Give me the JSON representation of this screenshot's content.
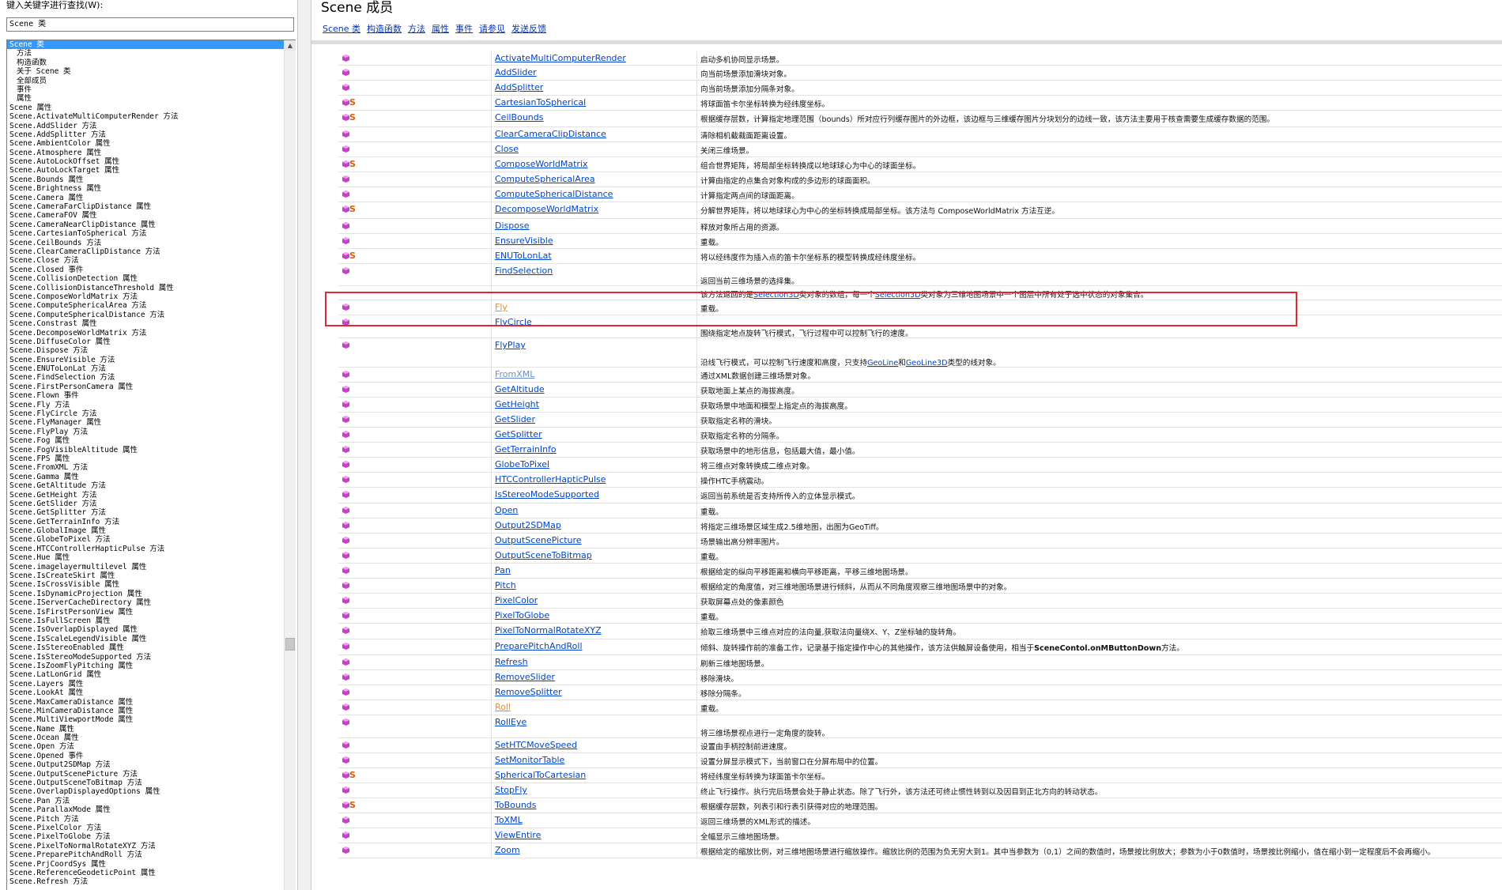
{
  "left_pane": {
    "search_label": "键入关键字进行查找(W):",
    "search_value": "Scene 类",
    "index_items": [
      {
        "text": "Scene 类",
        "selected": true,
        "sub": false
      },
      {
        "text": "方法",
        "selected": false,
        "sub": true
      },
      {
        "text": "构造函数",
        "selected": false,
        "sub": true
      },
      {
        "text": "关于 Scene 类",
        "selected": false,
        "sub": true
      },
      {
        "text": "全部成员",
        "selected": false,
        "sub": true
      },
      {
        "text": "事件",
        "selected": false,
        "sub": true
      },
      {
        "text": "属性",
        "selected": false,
        "sub": true
      },
      {
        "text": "Scene 属性",
        "selected": false,
        "sub": false
      },
      {
        "text": "Scene.ActivateMultiComputerRender 方法",
        "selected": false,
        "sub": false
      },
      {
        "text": "Scene.AddSlider 方法",
        "selected": false,
        "sub": false
      },
      {
        "text": "Scene.AddSplitter 方法",
        "selected": false,
        "sub": false
      },
      {
        "text": "Scene.AmbientColor 属性",
        "selected": false,
        "sub": false
      },
      {
        "text": "Scene.Atmosphere 属性",
        "selected": false,
        "sub": false
      },
      {
        "text": "Scene.AutoLockOffset 属性",
        "selected": false,
        "sub": false
      },
      {
        "text": "Scene.AutoLockTarget 属性",
        "selected": false,
        "sub": false
      },
      {
        "text": "Scene.Bounds 属性",
        "selected": false,
        "sub": false
      },
      {
        "text": "Scene.Brightness 属性",
        "selected": false,
        "sub": false
      },
      {
        "text": "Scene.Camera 属性",
        "selected": false,
        "sub": false
      },
      {
        "text": "Scene.CameraFarClipDistance 属性",
        "selected": false,
        "sub": false
      },
      {
        "text": "Scene.CameraFOV 属性",
        "selected": false,
        "sub": false
      },
      {
        "text": "Scene.CameraNearClipDistance 属性",
        "selected": false,
        "sub": false
      },
      {
        "text": "Scene.CartesianToSpherical 方法",
        "selected": false,
        "sub": false
      },
      {
        "text": "Scene.CeilBounds 方法",
        "selected": false,
        "sub": false
      },
      {
        "text": "Scene.ClearCameraClipDistance 方法",
        "selected": false,
        "sub": false
      },
      {
        "text": "Scene.Close 方法",
        "selected": false,
        "sub": false
      },
      {
        "text": "Scene.Closed 事件",
        "selected": false,
        "sub": false
      },
      {
        "text": "Scene.CollisionDetection 属性",
        "selected": false,
        "sub": false
      },
      {
        "text": "Scene.CollisionDistanceThreshold 属性",
        "selected": false,
        "sub": false
      },
      {
        "text": "Scene.ComposeWorldMatrix 方法",
        "selected": false,
        "sub": false
      },
      {
        "text": "Scene.ComputeSphericalArea 方法",
        "selected": false,
        "sub": false
      },
      {
        "text": "Scene.ComputeSphericalDistance 方法",
        "selected": false,
        "sub": false
      },
      {
        "text": "Scene.Constrast 属性",
        "selected": false,
        "sub": false
      },
      {
        "text": "Scene.DecomposeWorldMatrix 方法",
        "selected": false,
        "sub": false
      },
      {
        "text": "Scene.DiffuseColor 属性",
        "selected": false,
        "sub": false
      },
      {
        "text": "Scene.Dispose 方法",
        "selected": false,
        "sub": false
      },
      {
        "text": "Scene.EnsureVisible 方法",
        "selected": false,
        "sub": false
      },
      {
        "text": "Scene.ENUToLonLat 方法",
        "selected": false,
        "sub": false
      },
      {
        "text": "Scene.FindSelection 方法",
        "selected": false,
        "sub": false
      },
      {
        "text": "Scene.FirstPersonCamera 属性",
        "selected": false,
        "sub": false
      },
      {
        "text": "Scene.Flown 事件",
        "selected": false,
        "sub": false
      },
      {
        "text": "Scene.Fly 方法",
        "selected": false,
        "sub": false
      },
      {
        "text": "Scene.FlyCircle 方法",
        "selected": false,
        "sub": false
      },
      {
        "text": "Scene.FlyManager 属性",
        "selected": false,
        "sub": false
      },
      {
        "text": "Scene.FlyPlay 方法",
        "selected": false,
        "sub": false
      },
      {
        "text": "Scene.Fog 属性",
        "selected": false,
        "sub": false
      },
      {
        "text": "Scene.FogVisibleAltitude 属性",
        "selected": false,
        "sub": false
      },
      {
        "text": "Scene.FPS 属性",
        "selected": false,
        "sub": false
      },
      {
        "text": "Scene.FromXML 方法",
        "selected": false,
        "sub": false
      },
      {
        "text": "Scene.Gamma 属性",
        "selected": false,
        "sub": false
      },
      {
        "text": "Scene.GetAltitude 方法",
        "selected": false,
        "sub": false
      },
      {
        "text": "Scene.GetHeight 方法",
        "selected": false,
        "sub": false
      },
      {
        "text": "Scene.GetSlider 方法",
        "selected": false,
        "sub": false
      },
      {
        "text": "Scene.GetSplitter 方法",
        "selected": false,
        "sub": false
      },
      {
        "text": "Scene.GetTerrainInfo 方法",
        "selected": false,
        "sub": false
      },
      {
        "text": "Scene.GlobalImage 属性",
        "selected": false,
        "sub": false
      },
      {
        "text": "Scene.GlobeToPixel 方法",
        "selected": false,
        "sub": false
      },
      {
        "text": "Scene.HTCControllerHapticPulse 方法",
        "selected": false,
        "sub": false
      },
      {
        "text": "Scene.Hue 属性",
        "selected": false,
        "sub": false
      },
      {
        "text": "Scene.imagelayermultilevel 属性",
        "selected": false,
        "sub": false
      },
      {
        "text": "Scene.IsCreateSkirt 属性",
        "selected": false,
        "sub": false
      },
      {
        "text": "Scene.IsCrossVisible 属性",
        "selected": false,
        "sub": false
      },
      {
        "text": "Scene.IsDynamicProjection 属性",
        "selected": false,
        "sub": false
      },
      {
        "text": "Scene.IServerCacheDirectory 属性",
        "selected": false,
        "sub": false
      },
      {
        "text": "Scene.IsFirstPersonView 属性",
        "selected": false,
        "sub": false
      },
      {
        "text": "Scene.IsFullScreen 属性",
        "selected": false,
        "sub": false
      },
      {
        "text": "Scene.IsOverlapDisplayed 属性",
        "selected": false,
        "sub": false
      },
      {
        "text": "Scene.IsScaleLegendVisible 属性",
        "selected": false,
        "sub": false
      },
      {
        "text": "Scene.IsStereoEnabled 属性",
        "selected": false,
        "sub": false
      },
      {
        "text": "Scene.IsStereoModeSupported 方法",
        "selected": false,
        "sub": false
      },
      {
        "text": "Scene.IsZoomFlyPitching 属性",
        "selected": false,
        "sub": false
      },
      {
        "text": "Scene.LatLonGrid 属性",
        "selected": false,
        "sub": false
      },
      {
        "text": "Scene.Layers 属性",
        "selected": false,
        "sub": false
      },
      {
        "text": "Scene.LookAt 属性",
        "selected": false,
        "sub": false
      },
      {
        "text": "Scene.MaxCameraDistance 属性",
        "selected": false,
        "sub": false
      },
      {
        "text": "Scene.MinCameraDistance 属性",
        "selected": false,
        "sub": false
      },
      {
        "text": "Scene.MultiViewportMode 属性",
        "selected": false,
        "sub": false
      },
      {
        "text": "Scene.Name 属性",
        "selected": false,
        "sub": false
      },
      {
        "text": "Scene.Ocean 属性",
        "selected": false,
        "sub": false
      },
      {
        "text": "Scene.Open 方法",
        "selected": false,
        "sub": false
      },
      {
        "text": "Scene.Opened 事件",
        "selected": false,
        "sub": false
      },
      {
        "text": "Scene.Output2SDMap 方法",
        "selected": false,
        "sub": false
      },
      {
        "text": "Scene.OutputScenePicture 方法",
        "selected": false,
        "sub": false
      },
      {
        "text": "Scene.OutputSceneToBitmap 方法",
        "selected": false,
        "sub": false
      },
      {
        "text": "Scene.OverlapDisplayedOptions 属性",
        "selected": false,
        "sub": false
      },
      {
        "text": "Scene.Pan 方法",
        "selected": false,
        "sub": false
      },
      {
        "text": "Scene.ParallaxMode 属性",
        "selected": false,
        "sub": false
      },
      {
        "text": "Scene.Pitch 方法",
        "selected": false,
        "sub": false
      },
      {
        "text": "Scene.PixelColor 方法",
        "selected": false,
        "sub": false
      },
      {
        "text": "Scene.PixelToGlobe 方法",
        "selected": false,
        "sub": false
      },
      {
        "text": "Scene.PixelToNormalRotateXYZ 方法",
        "selected": false,
        "sub": false
      },
      {
        "text": "Scene.PreparePitchAndRoll 方法",
        "selected": false,
        "sub": false
      },
      {
        "text": "Scene.PrjCoordSys 属性",
        "selected": false,
        "sub": false
      },
      {
        "text": "Scene.ReferenceGeodeticPoint 属性",
        "selected": false,
        "sub": false
      },
      {
        "text": "Scene.Refresh 方法",
        "selected": false,
        "sub": false
      }
    ],
    "scroll_up_glyph": "▲",
    "scroll_position": 0.72
  },
  "right_pane": {
    "title": "Scene 成员",
    "nav_links": [
      "Scene 类",
      "构造函数",
      "方法",
      "属性",
      "事件",
      "请参见",
      "发送反馈"
    ],
    "members": [
      {
        "name": "ActivateMultiComputerRender",
        "static": false,
        "desc": "启动多机协同显示场景。"
      },
      {
        "name": "AddSlider",
        "static": false,
        "desc": "向当前场景添加滑块对象。"
      },
      {
        "name": "AddSplitter",
        "static": false,
        "desc": "向当前场景添加分隔条对象。"
      },
      {
        "name": "CartesianToSpherical",
        "static": true,
        "desc": "将球面笛卡尔坐标转换为经纬度坐标。"
      },
      {
        "name": "CeilBounds",
        "static": true,
        "desc": "根据缓存层数，计算指定地理范围（bounds）所对应行列缓存图片的外边框，该边框与三维缓存图片分块划分的边线一致，该方法主要用于核查需要生成缓存数据的范围。"
      },
      {
        "name": "ClearCameraClipDistance",
        "static": false,
        "desc": "清除相机截裁面距离设置。"
      },
      {
        "name": "Close",
        "static": false,
        "desc": "关闭三维场景。"
      },
      {
        "name": "ComposeWorldMatrix",
        "static": true,
        "desc": "组合世界矩阵，将局部坐标转换成以地球球心为中心的球面坐标。"
      },
      {
        "name": "ComputeSphericalArea",
        "static": false,
        "desc": "计算由指定的点集合对象构成的多边形的球面面积。"
      },
      {
        "name": "ComputeSphericalDistance",
        "static": false,
        "desc": "计算指定两点间的球面距离。"
      },
      {
        "name": "DecomposeWorldMatrix",
        "static": true,
        "desc": "分解世界矩阵，将以地球球心为中心的坐标转换成局部坐标。该方法与 ComposeWorldMatrix 方法互逆。"
      },
      {
        "name": "Dispose",
        "static": false,
        "desc": "释放对象所占用的资源。"
      },
      {
        "name": "EnsureVisible",
        "static": false,
        "desc": "重载。"
      },
      {
        "name": "ENUToLonLat",
        "static": true,
        "desc": "将以经纬度作为插入点的笛卡尔坐标系的模型转换成经纬度坐标。"
      },
      {
        "name": "FindSelection",
        "static": false,
        "desc": "返回当前三维场景的选择集。"
      },
      {
        "name": "",
        "static": false,
        "desc_parts": [
          "该方法返回的是",
          "Selection3D",
          "类对象的数组，每一个",
          "Selection3D",
          "类对象为三维地图场景中一个图层中所有处于选中状态的对象集合。"
        ]
      },
      {
        "name": "Fly",
        "static": false,
        "desc": "重载。"
      },
      {
        "name": "FlyCircle",
        "static": false,
        "desc": "围绕指定地点旋转飞行模式，飞行过程中可以控制飞行的速度。"
      },
      {
        "name": "FlyPlay",
        "static": false,
        "desc_parts": [
          "沿线飞行模式，可以控制飞行速度和高度，只支持",
          "GeoLine",
          "和",
          "GeoLine3D",
          "类型的线对象。"
        ]
      },
      {
        "name": "FromXML",
        "static": false,
        "desc": "通过XML数据创建三维场景对象。"
      },
      {
        "name": "GetAltitude",
        "static": false,
        "desc": "获取地面上某点的海拔高度。"
      },
      {
        "name": "GetHeight",
        "static": false,
        "desc": "获取场景中地面和模型上指定点的海拔高度。"
      },
      {
        "name": "GetSlider",
        "static": false,
        "desc": "获取指定名称的滑块。"
      },
      {
        "name": "GetSplitter",
        "static": false,
        "desc": "获取指定名称的分隔条。"
      },
      {
        "name": "GetTerrainInfo",
        "static": false,
        "desc": "获取场景中的地形信息，包括最大值，最小值。"
      },
      {
        "name": "GlobeToPixel",
        "static": false,
        "desc": "将三维点对象转换成二维点对象。"
      },
      {
        "name": "HTCControllerHapticPulse",
        "static": false,
        "desc": "操作HTC手柄震动。"
      },
      {
        "name": "IsStereoModeSupported",
        "static": false,
        "desc": "返回当前系统是否支持所传入的立体显示模式。"
      },
      {
        "name": "Open",
        "static": false,
        "desc": "重载。"
      },
      {
        "name": "Output2SDMap",
        "static": false,
        "desc": "将指定三维场景区域生成2.5维地图，出图为GeoTiff。"
      },
      {
        "name": "OutputScenePicture",
        "static": false,
        "desc": "场景输出高分辨率图片。"
      },
      {
        "name": "OutputSceneToBitmap",
        "static": false,
        "desc": "重载。"
      },
      {
        "name": "Pan",
        "static": false,
        "desc": "根据给定的纵向平移距离和横向平移距离，平移三维地图场景。"
      },
      {
        "name": "Pitch",
        "static": false,
        "desc": "根据给定的角度值，对三维地图场景进行倾斜，从而从不同角度观察三维地图场景中的对象。"
      },
      {
        "name": "PixelColor",
        "static": false,
        "desc": "获取屏幕点处的像素颜色"
      },
      {
        "name": "PixelToGlobe",
        "static": false,
        "desc": "重载。"
      },
      {
        "name": "PixelToNormalRotateXYZ",
        "static": false,
        "desc": "拾取三维场景中三维点对应的法向量,获取法向量绕X、Y、Z坐标轴的旋转角。"
      },
      {
        "name": "PreparePitchAndRoll",
        "static": false,
        "desc_parts": [
          "倾斜、旋转操作前的准备工作，记录基于指定操作中心的其他操作，该方法供触屏设备使用，相当于",
          "SceneContol.onMButtonDown",
          "方法。"
        ]
      },
      {
        "name": "Refresh",
        "static": false,
        "desc": "刷新三维地图场景。"
      },
      {
        "name": "RemoveSlider",
        "static": false,
        "desc": "移除滑块。"
      },
      {
        "name": "RemoveSplitter",
        "static": false,
        "desc": "移除分隔条。"
      },
      {
        "name": "Roll",
        "static": false,
        "desc": "重载。"
      },
      {
        "name": "RollEye",
        "static": false,
        "desc": "将三维场景视点进行一定角度的旋转。"
      },
      {
        "name": "SetHTCMoveSpeed",
        "static": false,
        "desc": "设置由手柄控制前进速度。"
      },
      {
        "name": "SetMonitorTable",
        "static": false,
        "desc": "设置分屏显示模式下，当前窗口在分屏布局中的位置。"
      },
      {
        "name": "SphericalToCartesian",
        "static": true,
        "desc": "将经纬度坐标转换为球面笛卡尔坐标。"
      },
      {
        "name": "StopFly",
        "static": false,
        "desc": "终止飞行操作。执行完后场景会处于静止状态。除了飞行外，该方法还可终止惯性转到以及因目到正北方向的转动状态。"
      },
      {
        "name": "ToBounds",
        "static": true,
        "desc": "根据缓存层数，列表引和行表引获得对应的地理范围。"
      },
      {
        "name": "ToXML",
        "static": false,
        "desc": "返回三维场景的XML形式的描述。"
      },
      {
        "name": "ViewEntire",
        "static": false,
        "desc": "全幅显示三维地图场景。"
      },
      {
        "name": "Zoom",
        "static": false,
        "desc": "根据给定的缩放比例，对三维地图场景进行缩放操作。缩放比例的范围为负无穷大到1。其中当参数为（0,1）之间的数值时，场景按比例放大；参数为小于0数值时，场景按比例缩小，值在缩小到一定程度后不会再缩小。"
      }
    ],
    "colors": {
      "link": "#0044cc",
      "highlight_border": "#e0282d",
      "method_icon": "#c640c8",
      "static_icon": "#e05a00"
    },
    "icons": {
      "method": "method-icon",
      "static": "static-icon"
    }
  }
}
